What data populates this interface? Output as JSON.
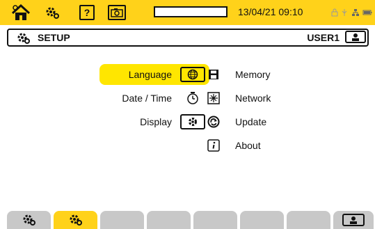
{
  "status_bar": {
    "datetime": "13/04/21 09:10",
    "icons": [
      "home-icon",
      "setup-icon",
      "help-icon",
      "camera-icon",
      "lock-icon",
      "usb-icon",
      "network-icon",
      "battery-icon"
    ],
    "status_text": "\b ↓ ☷",
    "accent_color": "#ffd21a"
  },
  "header": {
    "title": "SETUP",
    "user": "USER1"
  },
  "menu": {
    "left": [
      {
        "label": "Language",
        "icon": "globe-icon",
        "selected": true
      },
      {
        "label": "Date / Time",
        "icon": "stopwatch-icon",
        "selected": false
      },
      {
        "label": "Display",
        "icon": "display-icon",
        "selected": false
      }
    ],
    "right": [
      {
        "label": "Memory",
        "icon": "floppy-icon"
      },
      {
        "label": "Network",
        "icon": "network-icon"
      },
      {
        "label": "Update",
        "icon": "update-icon"
      },
      {
        "label": "About",
        "icon": "info-icon"
      }
    ],
    "highlight_color": "#ffe600"
  },
  "tabs": {
    "items": [
      "setup-icon",
      "setup-icon",
      "",
      "",
      "",
      "",
      "",
      "user-icon"
    ],
    "active_index": 1
  }
}
